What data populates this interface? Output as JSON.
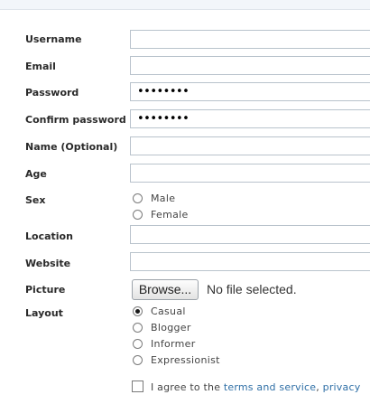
{
  "form": {
    "username": {
      "label": "Username",
      "value": ""
    },
    "email": {
      "label": "Email",
      "value": ""
    },
    "password": {
      "label": "Password",
      "masked_value": "••••••••"
    },
    "confirm_password": {
      "label": "Confirm password",
      "masked_value": "••••••••"
    },
    "name": {
      "label": "Name (Optional)",
      "value": ""
    },
    "age": {
      "label": "Age",
      "value": ""
    },
    "sex": {
      "label": "Sex",
      "options": [
        {
          "label": "Male",
          "checked": false
        },
        {
          "label": "Female",
          "checked": false
        }
      ]
    },
    "location": {
      "label": "Location",
      "value": ""
    },
    "website": {
      "label": "Website",
      "value": ""
    },
    "picture": {
      "label": "Picture",
      "browse_label": "Browse...",
      "status": "No file selected."
    },
    "layout": {
      "label": "Layout",
      "options": [
        {
          "label": "Casual",
          "checked": true
        },
        {
          "label": "Blogger",
          "checked": false
        },
        {
          "label": "Informer",
          "checked": false
        },
        {
          "label": "Expressionist",
          "checked": false
        }
      ]
    },
    "agree": {
      "prefix": "I agree to the ",
      "terms_link": "terms and service",
      "separator": ", ",
      "privacy_link": "privacy"
    }
  }
}
